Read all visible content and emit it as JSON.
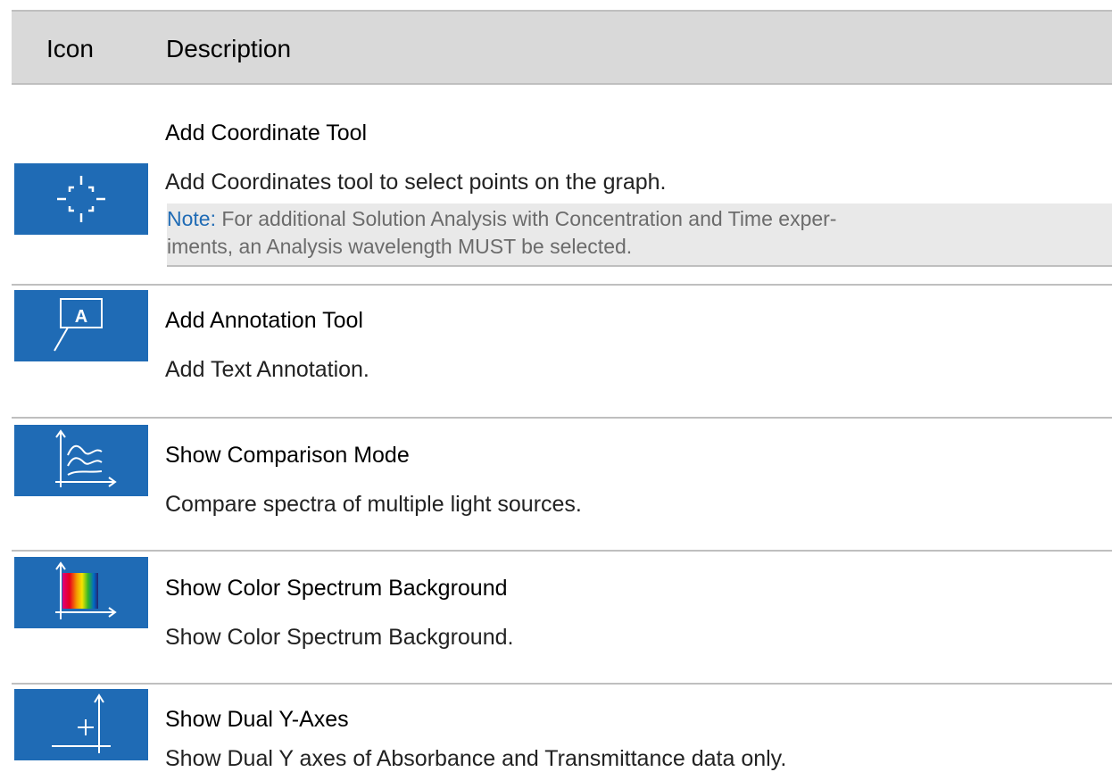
{
  "header": {
    "icon_col": "Icon",
    "desc_col": "Description"
  },
  "rows": [
    {
      "title": "Add Coordinate Tool",
      "description": "Add Coordinates tool to select points on the graph.",
      "icon": "crosshair-icon",
      "note": {
        "label": "Note:",
        "line1": "For additional Solution Analysis with Concentration and Time exper-",
        "line2": "iments, an Analysis wavelength MUST be selected."
      }
    },
    {
      "title": "Add Annotation Tool",
      "description": "Add Text Annotation.",
      "icon": "annotation-icon",
      "icon_letter": "A"
    },
    {
      "title": "Show Comparison Mode",
      "description": "Compare spectra of multiple light sources.",
      "icon": "comparison-graph-icon"
    },
    {
      "title": "Show Color Spectrum Background",
      "description": "Show Color Spectrum Background.",
      "icon": "color-spectrum-icon"
    },
    {
      "title": "Show Dual Y-Axes",
      "description": "Show Dual Y axes of Absorbance and Transmittance data only.",
      "icon": "dual-y-axes-icon"
    }
  ],
  "colors": {
    "icon_background": "#1f6bb5",
    "header_background": "#d9d9d9",
    "note_label": "#1f6bb5",
    "note_background": "#e9e9e9"
  }
}
